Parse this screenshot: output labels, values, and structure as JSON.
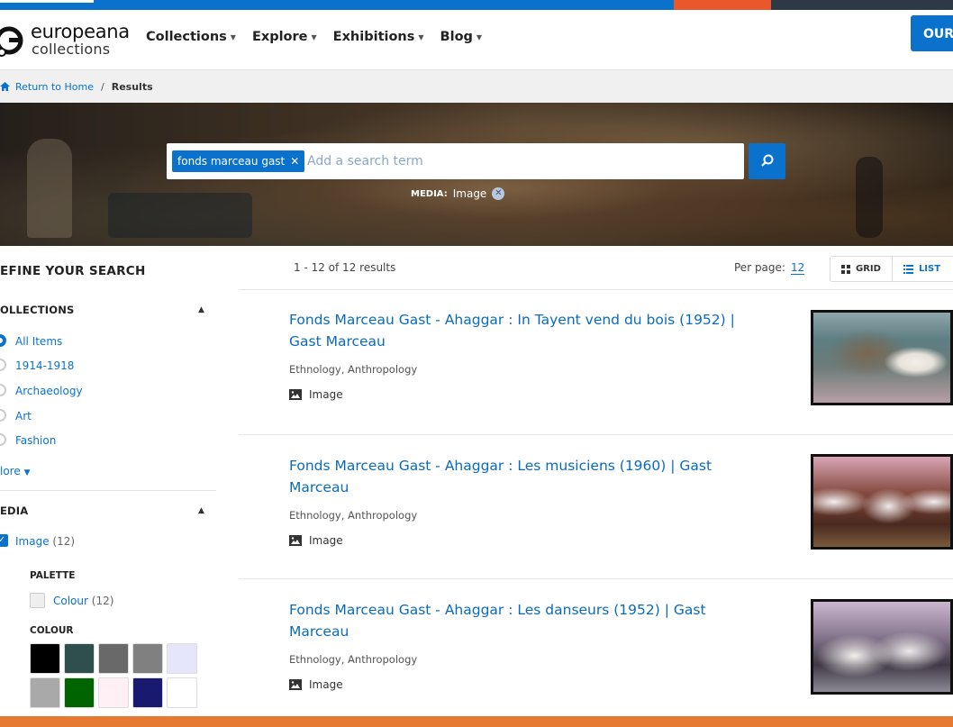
{
  "brand": {
    "line1": "europeana",
    "line2": "collections"
  },
  "nav": [
    {
      "label": "Collections"
    },
    {
      "label": "Explore"
    },
    {
      "label": "Exhibitions"
    },
    {
      "label": "Blog"
    }
  ],
  "header_button": "OUR",
  "breadcrumb": {
    "home": "Return to Home",
    "separator": "/",
    "current": "Results"
  },
  "search": {
    "chip": "fonds marceau gast",
    "placeholder": "Add a search term"
  },
  "active_filter": {
    "key": "MEDIA:",
    "value": "Image"
  },
  "sidebar": {
    "title": "EFINE YOUR SEARCH",
    "collections": {
      "heading": "OLLECTIONS",
      "items": [
        "All Items",
        "1914-1918",
        "Archaeology",
        "Art",
        "Fashion"
      ],
      "more": "lore"
    },
    "media": {
      "heading": "EDIA",
      "item": {
        "label": "Image",
        "count": "(12)"
      },
      "palette_heading": "PALETTE",
      "palette_item": {
        "label": "Colour",
        "count": "(12)"
      },
      "colour_heading": "COLOUR",
      "swatches": [
        "#000000",
        "#2f4f4f",
        "#696969",
        "#808080",
        "#e6e6fa",
        "#a9a9a9",
        "#006400",
        "#fff0f5",
        "#191970",
        "#ffffff"
      ]
    }
  },
  "results": {
    "count_text": "1 - 12 of 12 results",
    "per_page_label": "Per page:",
    "per_page_value": "12",
    "view_grid": "GRID",
    "view_list": "LIST",
    "items": [
      {
        "title": "Fonds Marceau Gast - Ahaggar : In Tayent vend du bois (1952) | Gast Marceau",
        "meta": "Ethnology,  Anthropology",
        "type": "Image"
      },
      {
        "title": "Fonds Marceau Gast - Ahaggar : Les musiciens (1960) | Gast Marceau",
        "meta": "Ethnology,  Anthropology",
        "type": "Image"
      },
      {
        "title": "Fonds Marceau Gast - Ahaggar : Les danseurs (1952) | Gast Marceau",
        "meta": "Ethnology,  Anthropology",
        "type": "Image"
      }
    ]
  },
  "colors": {
    "accent": "#0a72cc",
    "orange": "#e67a32"
  }
}
